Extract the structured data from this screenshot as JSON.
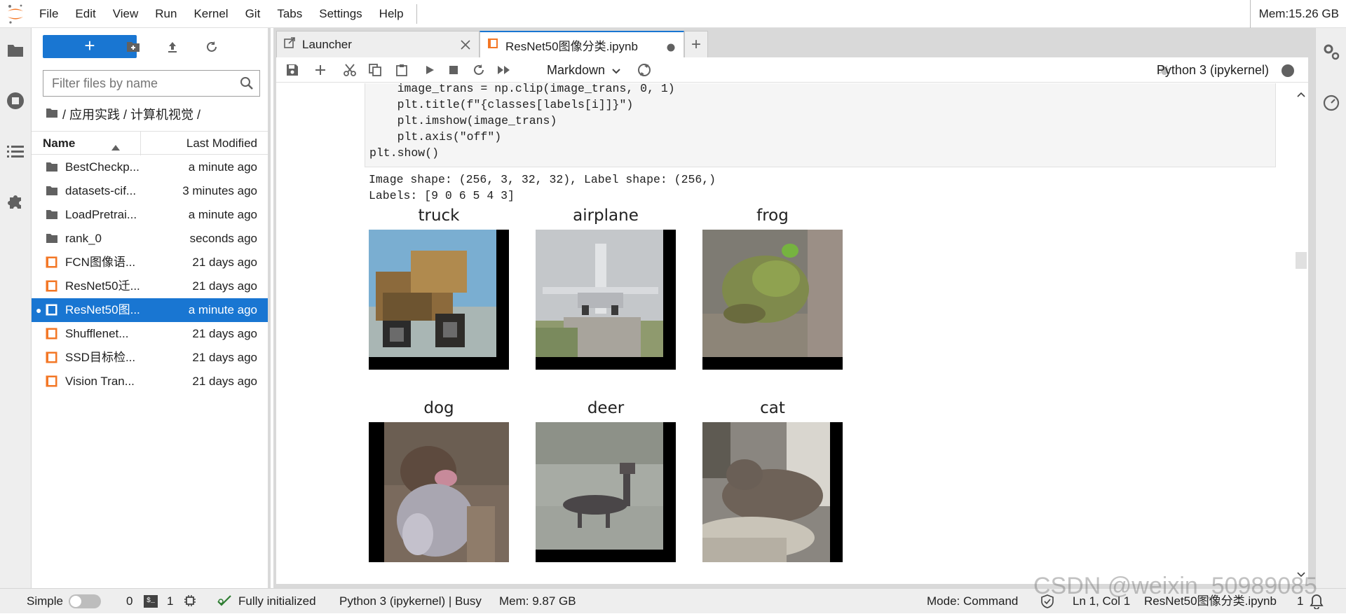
{
  "menubar": {
    "items": [
      "File",
      "Edit",
      "View",
      "Run",
      "Kernel",
      "Git",
      "Tabs",
      "Settings",
      "Help"
    ],
    "memory": "Mem:15.26 GB"
  },
  "filebrowser": {
    "new_button": "+",
    "filter_placeholder": "Filter files by name",
    "breadcrumb": "/ 应用实践 / 计算机视觉 /",
    "col_name": "Name",
    "col_modified": "Last Modified",
    "files": [
      {
        "name": "BestCheckp...",
        "modified": "a minute ago",
        "type": "folder",
        "selected": false
      },
      {
        "name": "datasets-cif...",
        "modified": "3 minutes ago",
        "type": "folder",
        "selected": false
      },
      {
        "name": "LoadPretrai...",
        "modified": "a minute ago",
        "type": "folder",
        "selected": false
      },
      {
        "name": "rank_0",
        "modified": "seconds ago",
        "type": "folder",
        "selected": false
      },
      {
        "name": "FCN图像语...",
        "modified": "21 days ago",
        "type": "notebook",
        "selected": false
      },
      {
        "name": "ResNet50迁...",
        "modified": "21 days ago",
        "type": "notebook",
        "selected": false
      },
      {
        "name": "ResNet50图...",
        "modified": "a minute ago",
        "type": "notebook",
        "selected": true
      },
      {
        "name": "Shufflenet...",
        "modified": "21 days ago",
        "type": "notebook",
        "selected": false
      },
      {
        "name": "SSD目标检...",
        "modified": "21 days ago",
        "type": "notebook",
        "selected": false
      },
      {
        "name": "Vision Tran...",
        "modified": "21 days ago",
        "type": "notebook",
        "selected": false
      }
    ]
  },
  "tabs": [
    {
      "label": "Launcher",
      "active": false
    },
    {
      "label": "ResNet50图像分类.ipynb",
      "active": true
    }
  ],
  "toolbar": {
    "cell_type": "Markdown",
    "kernel": "Python 3 (ipykernel)"
  },
  "code_lines": [
    "    image_trans = np.clip(image_trans, 0, 1)",
    "    plt.title(f\"{classes[labels[i]]}\")",
    "    plt.imshow(image_trans)",
    "    plt.axis(\"off\")",
    "plt.show()"
  ],
  "output": {
    "line1": "Image shape: (256, 3, 32, 32), Label shape: (256,)",
    "line2": "Labels: [9 0 6 5 4 3]"
  },
  "images": [
    {
      "title": "truck"
    },
    {
      "title": "airplane"
    },
    {
      "title": "frog"
    },
    {
      "title": "dog"
    },
    {
      "title": "deer"
    },
    {
      "title": "cat"
    }
  ],
  "statusbar": {
    "simple": "Simple",
    "count1": "0",
    "count2": "1",
    "init": "Fully initialized",
    "kernel_state": "Python 3 (ipykernel) | Busy",
    "mem": "Mem: 9.87 GB",
    "mode": "Mode: Command",
    "position": "Ln 1, Col 1",
    "filename": "ResNet50图像分类.ipynb",
    "notif_count": "1"
  },
  "watermark": "CSDN @weixin_50989085"
}
